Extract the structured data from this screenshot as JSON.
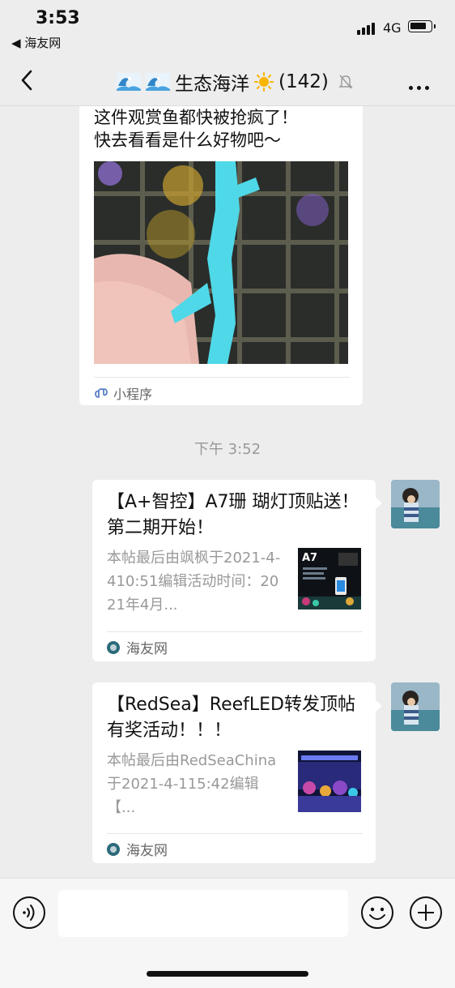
{
  "status_bar": {
    "time": "3:53",
    "back_app": "◀ 海友网",
    "network": "4G"
  },
  "navbar": {
    "title": "生态海洋",
    "member_count": "(142)"
  },
  "mini_program_card": {
    "text_line1": "这件观赏鱼都快被抢疯了！",
    "text_line2": "快去看看是什么好物吧～",
    "source_label": "小程序"
  },
  "timestamp": "下午 3:52",
  "messages": [
    {
      "title": "【A+智控】A7珊 瑚灯顶贴送！第二期开始！",
      "desc": "本帖最后由飒枫于2021-4-410:51编辑活动时间：2021年4月...",
      "source": "海友网",
      "thumb_text": "A7"
    },
    {
      "title": "【RedSea】ReefLED转发顶帖有奖活动！！！",
      "desc": "本帖最后由RedSeaChina于2021-4-115:42编辑【...",
      "source": "海友网"
    }
  ],
  "colors": {
    "background": "#ededed",
    "bubble": "#ffffff",
    "muted_text": "#999999"
  },
  "icons": [
    "wave-emoji",
    "sun-emoji",
    "mute-bell-icon",
    "more-icon",
    "voice-icon",
    "emoji-icon",
    "plus-icon",
    "mini-program-icon"
  ]
}
